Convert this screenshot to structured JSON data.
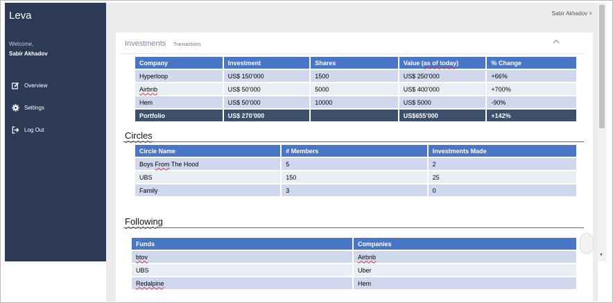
{
  "sidebar": {
    "brand": "Leva",
    "welcome": "Welcome,",
    "user_name": "Sabir Akhadov",
    "items": [
      {
        "label": "Overview",
        "icon": "edit-icon"
      },
      {
        "label": "Settings",
        "icon": "gear-icon"
      },
      {
        "label": "Log Out",
        "icon": "sign-out-icon"
      }
    ]
  },
  "topbar": {
    "user_menu": "Sabir Akhadov ˅"
  },
  "panel": {
    "title": "Investments",
    "subtitle": "Transactions",
    "collapse_icon": "chevron-up-icon"
  },
  "investments": {
    "headers": [
      "Company",
      "Investment",
      "Shares",
      "Value (as of today)",
      "% Change"
    ],
    "rows": [
      [
        "Hyperloop",
        "US$ 150’000",
        "1500",
        "US$ 250’000",
        "+66%"
      ],
      [
        "Airbnb",
        "US$ 50’000",
        "5000",
        "US$ 400’000",
        "+700%"
      ],
      [
        "Hem",
        "US$ 50’000",
        "10000",
        "US$ 5000",
        "-90%"
      ]
    ],
    "total": [
      "Portfolio",
      "US$ 270’000",
      "",
      "US$655’000",
      "+142%"
    ]
  },
  "circles": {
    "title": "Circles",
    "headers": [
      "Circle Name",
      "# Members",
      "Investments Made"
    ],
    "rows": [
      [
        "Boys From The Hood",
        "5",
        "2"
      ],
      [
        "UBS",
        "150",
        "25"
      ],
      [
        "Family",
        "3",
        "0"
      ]
    ]
  },
  "following": {
    "title": "Following",
    "headers": [
      "Funds",
      "Companies"
    ],
    "rows": [
      [
        "btov",
        "Airbnb"
      ],
      [
        "UBS",
        "Uber"
      ],
      [
        "Redalpine",
        "Hem"
      ]
    ]
  },
  "colors": {
    "sidebar": "#2d3a55",
    "table_header": "#4a76c7",
    "row_odd": "#d0d8ed",
    "row_even": "#e9edf6",
    "total_row": "#3c4f6b"
  }
}
